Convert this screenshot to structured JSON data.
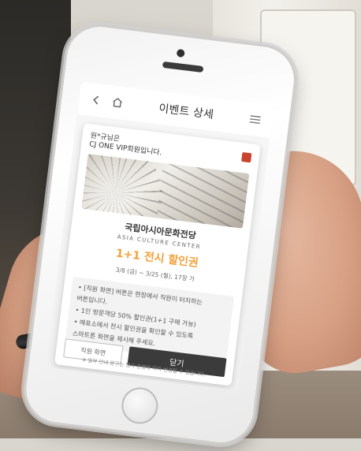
{
  "app": {
    "header": {
      "title": "이벤트 상세",
      "icons": {
        "back": "chevron-left-icon",
        "home": "home-icon",
        "menu": "hamburger-icon"
      }
    }
  },
  "event_card": {
    "greeting": "원*규님은",
    "membership": "CJ ONE VIP회원입니다.",
    "venue_korean": "국립아시아문화전당",
    "venue_english": "ASIA CULTURE CENTER",
    "offer": "1+1 전시 할인권",
    "date_range": "3/8 (금) ~ 3/25 (월), 17장 가",
    "notes": [
      "• [직원 화면] 버튼은 현장에서 직원이 터치하는",
      "  버튼입니다.",
      "• 1인 방문객당 50% 할인권(1+1 구매 가능)",
      "• 매표소에서 전시 할인권을 확인할 수 있도록",
      "  스마트폰 화면을 제시해 주세요."
    ],
    "buttons": {
      "staff_view": "직원 화면",
      "close": "닫기"
    }
  },
  "screen_footer": "※ 일부 안내 문구는 행사 운영에 따라 변경될 수 있습니다."
}
